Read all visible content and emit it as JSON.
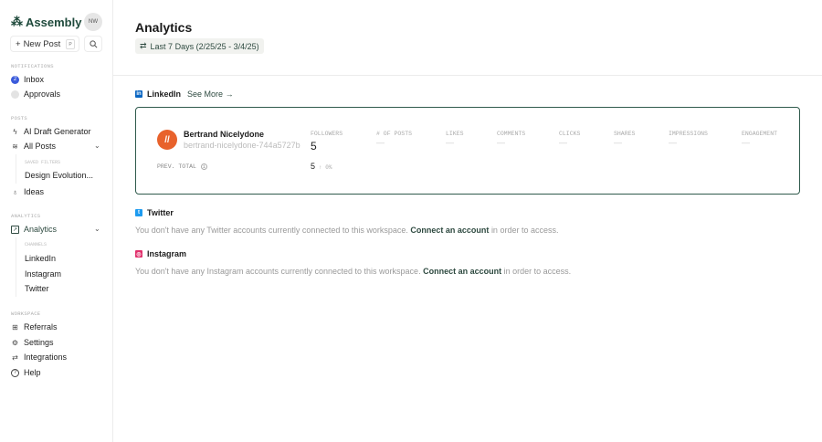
{
  "sidebar": {
    "logo": "Assembly",
    "avatar": "NW",
    "new_post": "New Post",
    "shortcut": "P",
    "notifications_label": "NOTIFICATIONS",
    "inbox": "Inbox",
    "inbox_count": "2",
    "approvals": "Approvals",
    "posts_label": "POSTS",
    "ai_draft": "AI Draft Generator",
    "all_posts": "All Posts",
    "saved_filters": "SAVED FILTERS",
    "design_evolution": "Design Evolution...",
    "ideas": "Ideas",
    "analytics_label": "ANALYTICS",
    "analytics": "Analytics",
    "channels": "CHANNELS",
    "linkedin": "LinkedIn",
    "instagram": "Instagram",
    "twitter": "Twitter",
    "workspace_label": "WORKSPACE",
    "referrals": "Referrals",
    "settings": "Settings",
    "integrations": "Integrations",
    "help": "Help"
  },
  "header": {
    "title": "Analytics",
    "date_range": "Last 7 Days (2/25/25 - 3/4/25)"
  },
  "linkedin": {
    "title": "LinkedIn",
    "see_more": "See More",
    "name": "Bertrand Nicelydone",
    "handle": "bertrand-nicelydone-744a5727b",
    "prev_total_label": "PREV. TOTAL",
    "prev_total": "5",
    "change": "↑ 0%",
    "metrics": [
      {
        "label": "FOLLOWERS",
        "value": "5"
      },
      {
        "label": "# OF POSTS",
        "value": "—"
      },
      {
        "label": "LIKES",
        "value": "—"
      },
      {
        "label": "COMMENTS",
        "value": "—"
      },
      {
        "label": "CLICKS",
        "value": "—"
      },
      {
        "label": "SHARES",
        "value": "—"
      },
      {
        "label": "IMPRESSIONS",
        "value": "—"
      },
      {
        "label": "ENGAGEMENT",
        "value": "—"
      }
    ]
  },
  "twitter": {
    "title": "Twitter",
    "msg_pre": "You don't have any Twitter accounts currently connected to this workspace.",
    "link": "Connect an account",
    "msg_post": "in order to access."
  },
  "instagram": {
    "title": "Instagram",
    "msg_pre": "You don't have any Instagram accounts currently connected to this workspace.",
    "link": "Connect an account",
    "msg_post": "in order to access."
  },
  "colors": {
    "accent": "#2e4a40",
    "linkedin": "#0a66c2",
    "twitter": "#1d9bf0",
    "instagram": "#e1306c",
    "avatar": "#e8622c"
  }
}
